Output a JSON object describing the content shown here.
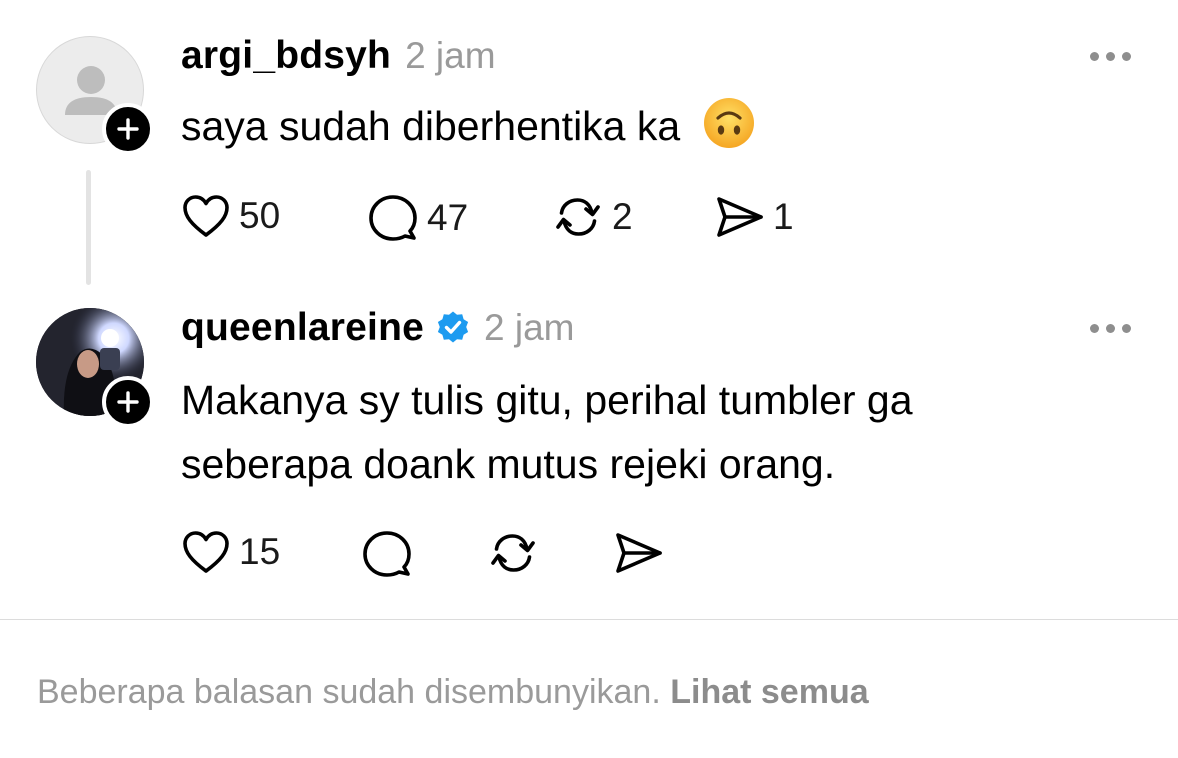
{
  "posts": [
    {
      "username": "argi_bdsyh",
      "verified": false,
      "time": "2 jam",
      "text": "saya sudah diberhentika ka",
      "emoji": "🙃",
      "likes": "50",
      "replies": "47",
      "reposts": "2",
      "shares": "1"
    },
    {
      "username": "queenlareine",
      "verified": true,
      "time": "2 jam",
      "text_line1": "Makanya sy tulis gitu, perihal tumbler ga",
      "text_line2": "seberapa doank mutus rejeki orang.",
      "likes": "15"
    }
  ],
  "footer": {
    "text": "Beberapa balasan sudah disembunyikan.",
    "link": "Lihat semua"
  },
  "colors": {
    "verified_badge": "#1d9bf0",
    "muted_text": "#9a9a9a"
  }
}
